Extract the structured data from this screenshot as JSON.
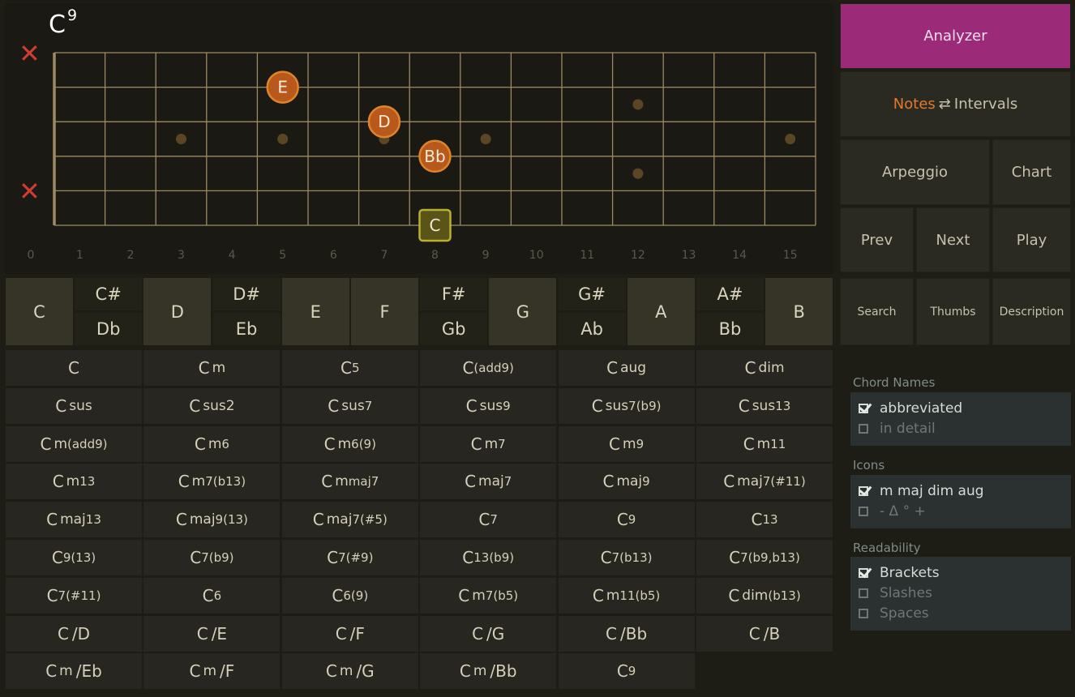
{
  "chord_title": {
    "root": "C",
    "ext": "9"
  },
  "fretboard": {
    "fret_numbers": [
      "0",
      "1",
      "2",
      "3",
      "4",
      "5",
      "6",
      "7",
      "8",
      "9",
      "10",
      "11",
      "12",
      "13",
      "14",
      "15"
    ],
    "muted_marker": "✕",
    "dots": [
      {
        "fret": 3,
        "string": 3
      },
      {
        "fret": 5,
        "string": 3
      },
      {
        "fret": 7,
        "string": 3
      },
      {
        "fret": 9,
        "string": 3
      },
      {
        "fret": 15,
        "string": 3
      },
      {
        "fret": 12,
        "string": 2
      },
      {
        "fret": 12,
        "string": 4
      }
    ],
    "notes": [
      {
        "label": "E",
        "fret": 5,
        "string": 2,
        "root": false
      },
      {
        "label": "D",
        "fret": 7,
        "string": 3,
        "root": false
      },
      {
        "label": "Bb",
        "fret": 8,
        "string": 4,
        "root": false
      },
      {
        "label": "C",
        "fret": 8,
        "string": 6,
        "root": true
      }
    ],
    "colors": {
      "note_fill": "#b8581a",
      "note_ring": "#e0842c",
      "root_fill": "#5b5418",
      "root_ring": "#b8b030",
      "dot": "#5b4624",
      "line": "#9d8a63"
    }
  },
  "right_panel": {
    "analyzer": "Analyzer",
    "notes_word": "Notes",
    "swap": "⇄",
    "intervals_word": "Intervals",
    "arpeggio": "Arpeggio",
    "chart": "Chart",
    "prev": "Prev",
    "next": "Next",
    "play": "Play",
    "search": "Search",
    "thumbs": "Thumbs",
    "description": "Description"
  },
  "keys": {
    "naturals": [
      "C",
      "D",
      "E",
      "F",
      "G",
      "A",
      "B"
    ],
    "sharps": [
      "C#",
      "D#",
      "F#",
      "G#",
      "A#"
    ],
    "flats": [
      "Db",
      "Eb",
      "Gb",
      "Ab",
      "Bb"
    ]
  },
  "chords": [
    [
      "C",
      "",
      "",
      ""
    ],
    [
      "C",
      "m",
      "",
      ""
    ],
    [
      "C",
      "",
      "",
      "5"
    ],
    [
      "C",
      "",
      "",
      "(add9)"
    ],
    [
      "C",
      "aug",
      "",
      ""
    ],
    [
      "C",
      "dim",
      "",
      ""
    ],
    [
      "C",
      "sus",
      "",
      ""
    ],
    [
      "C",
      "sus2",
      "",
      ""
    ],
    [
      "C",
      "sus",
      "",
      "7"
    ],
    [
      "C",
      "sus",
      "",
      "9"
    ],
    [
      "C",
      "sus",
      "",
      "7",
      "(b9)"
    ],
    [
      "C",
      "sus",
      "",
      "13"
    ],
    [
      "C",
      "m",
      "",
      "(add9)"
    ],
    [
      "C",
      "m",
      "",
      "6"
    ],
    [
      "C",
      "m",
      "",
      "6(9)"
    ],
    [
      "C",
      "m",
      "",
      "7"
    ],
    [
      "C",
      "m",
      "",
      "9"
    ],
    [
      "C",
      "m",
      "",
      "11"
    ],
    [
      "C",
      "m",
      "",
      "13"
    ],
    [
      "C",
      "m",
      "",
      "7(b13)"
    ],
    [
      "C",
      "m",
      "",
      "maj7"
    ],
    [
      "C",
      "maj",
      "",
      "7"
    ],
    [
      "C",
      "maj",
      "",
      "9"
    ],
    [
      "C",
      "maj",
      "",
      "7(#11)"
    ],
    [
      "C",
      "maj",
      "",
      "13"
    ],
    [
      "C",
      "maj",
      "",
      "9(13)"
    ],
    [
      "C",
      "maj",
      "",
      "7(#5)"
    ],
    [
      "C",
      "",
      "",
      "7"
    ],
    [
      "C",
      "",
      "",
      "9"
    ],
    [
      "C",
      "",
      "",
      "13"
    ],
    [
      "C",
      "",
      "",
      "9(13)"
    ],
    [
      "C",
      "",
      "",
      "7(b9)"
    ],
    [
      "C",
      "",
      "",
      "7(#9)"
    ],
    [
      "C",
      "",
      "",
      "13(b9)"
    ],
    [
      "C",
      "",
      "",
      "7(b13)"
    ],
    [
      "C",
      "",
      "",
      "7(b9,b13)"
    ],
    [
      "C",
      "",
      "",
      "7(#11)"
    ],
    [
      "C",
      "",
      "",
      "6"
    ],
    [
      "C",
      "",
      "",
      "6(9)"
    ],
    [
      "C",
      "m",
      "",
      "7(b5)"
    ],
    [
      "C",
      "m",
      "",
      "11(b5)"
    ],
    [
      "C",
      "dim",
      "",
      "(b13)"
    ],
    [
      "C",
      "",
      "/D",
      ""
    ],
    [
      "C",
      "",
      "/E",
      ""
    ],
    [
      "C",
      "",
      "/F",
      ""
    ],
    [
      "C",
      "",
      "/G",
      ""
    ],
    [
      "C",
      "",
      "/Bb",
      ""
    ],
    [
      "C",
      "",
      "/B",
      ""
    ],
    [
      "C",
      "m",
      "/Eb",
      ""
    ],
    [
      "C",
      "m",
      "/F",
      ""
    ],
    [
      "C",
      "m",
      "/G",
      ""
    ],
    [
      "C",
      "m",
      "/Bb",
      ""
    ],
    [
      "C",
      "",
      "",
      "9"
    ]
  ],
  "settings": {
    "chord_names_label": "Chord Names",
    "chord_names": [
      {
        "label": "abbreviated",
        "checked": true
      },
      {
        "label": "in detail",
        "checked": false
      }
    ],
    "icons_label": "Icons",
    "icons": [
      {
        "label": "m maj dim aug",
        "checked": true
      },
      {
        "label": "-   Δ   °   +",
        "checked": false
      }
    ],
    "readability_label": "Readability",
    "readability": [
      {
        "label": "Brackets",
        "checked": true
      },
      {
        "label": "Slashes",
        "checked": false
      },
      {
        "label": "Spaces",
        "checked": false
      }
    ]
  }
}
